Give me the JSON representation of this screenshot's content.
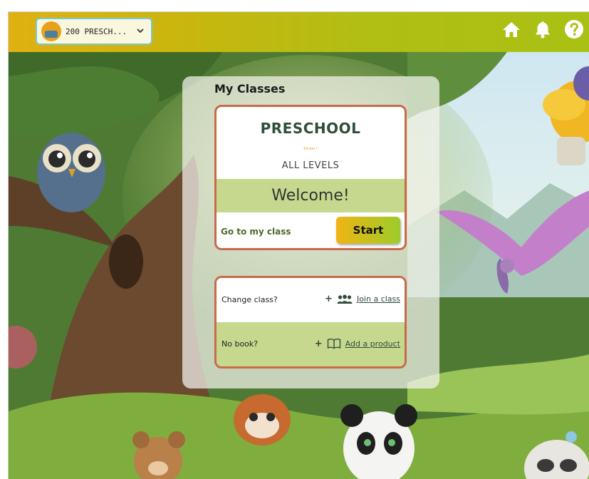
{
  "header": {
    "class_selector": {
      "value": "200 PRESCH...",
      "chevron": "chevron-down-icon"
    },
    "icons": [
      "home-icon",
      "bell-icon",
      "help-icon"
    ]
  },
  "panel": {
    "title": "My Classes",
    "class_card": {
      "name": "PRESCHOOL",
      "subtitle": "Kinder I",
      "level": "ALL LEVELS",
      "welcome": "Welcome!",
      "goto_label": "Go to my class",
      "start_label": "Start"
    },
    "options": {
      "change_class_label": "Change class?",
      "join_class_link": "Join a class",
      "no_book_label": "No book?",
      "add_product_link": "Add a product",
      "plus": "+"
    }
  },
  "colors": {
    "header_gradient_start": "#e0b110",
    "header_gradient_end": "#a9c114",
    "card_border": "#c96a4a",
    "band_green": "#c5d88e",
    "class_name": "#2f4e3c",
    "start_gradient_start": "#f0b414",
    "start_gradient_end": "#9ccc2a"
  }
}
